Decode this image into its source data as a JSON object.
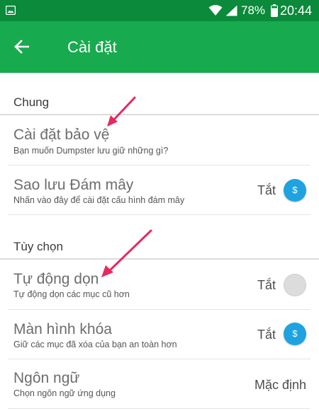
{
  "status_bar": {
    "battery": "78%",
    "time": "20:44"
  },
  "app_bar": {
    "title": "Cài đặt"
  },
  "sections": [
    {
      "header": "Chung",
      "rows": [
        {
          "title": "Cài đặt bảo vệ",
          "subtitle": "Bạn muốn Dumpster lưu giữ những gì?"
        },
        {
          "title": "Sao lưu Đám mây",
          "subtitle": "Nhấn vào đây để cài đặt cấu hình đám mây",
          "value": "Tắt",
          "toggle_state": "on",
          "toggle_glyph": "$"
        }
      ]
    },
    {
      "header": "Tùy chọn",
      "rows": [
        {
          "title": "Tự động dọn",
          "subtitle": "Tự động dọn các mục cũ hơn",
          "value": "Tắt",
          "toggle_state": "off"
        },
        {
          "title": "Màn hình khóa",
          "subtitle": "Giữ các mục đã xóa của bạn an toàn hơn",
          "value": "Tắt",
          "toggle_state": "on",
          "toggle_glyph": "$"
        },
        {
          "title": "Ngôn ngữ",
          "subtitle": "Chọn ngôn ngữ ứng dụng",
          "value": "Mặc định"
        }
      ]
    }
  ],
  "colors": {
    "status_bar": "#0a8a3a",
    "app_bar": "#18aa4f",
    "toggle_on": "#1ea3e0",
    "toggle_off": "#dcdcdc",
    "annotation_arrow": "#e8295f"
  }
}
